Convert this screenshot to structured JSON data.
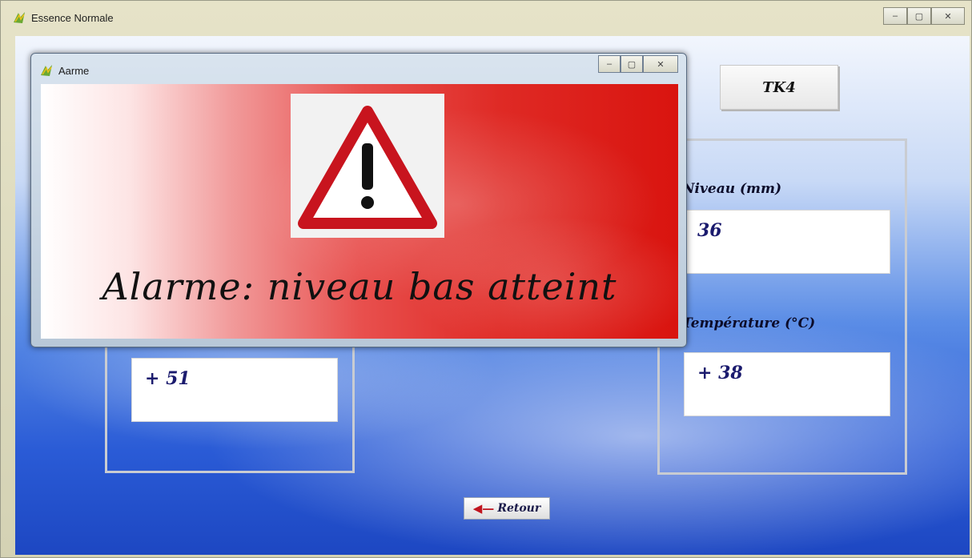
{
  "main_window": {
    "title": "Essence Normale",
    "controls": {
      "minimize": "–",
      "maximize": "▢",
      "close": "✕"
    }
  },
  "tank_button": {
    "label": "TK4"
  },
  "left_panel": {
    "value": "+ 51"
  },
  "right_panel": {
    "level_label": "Niveau (mm)",
    "level_value": "36",
    "temperature_label": "Température (°C)",
    "temperature_value": "+ 38"
  },
  "retour_button": {
    "label": "Retour",
    "icon": "arrow-left-icon"
  },
  "alarm_dialog": {
    "title": "Aarme",
    "message": "Alarme: niveau bas atteint",
    "icon": "warning-icon",
    "controls": {
      "minimize": "–",
      "maximize": "▢",
      "close": "✕"
    }
  },
  "colors": {
    "alarm_red": "#d9140f",
    "background_blue": "#2a5bd6",
    "value_text": "#1b1b6e",
    "warning_border": "#c8141e"
  }
}
